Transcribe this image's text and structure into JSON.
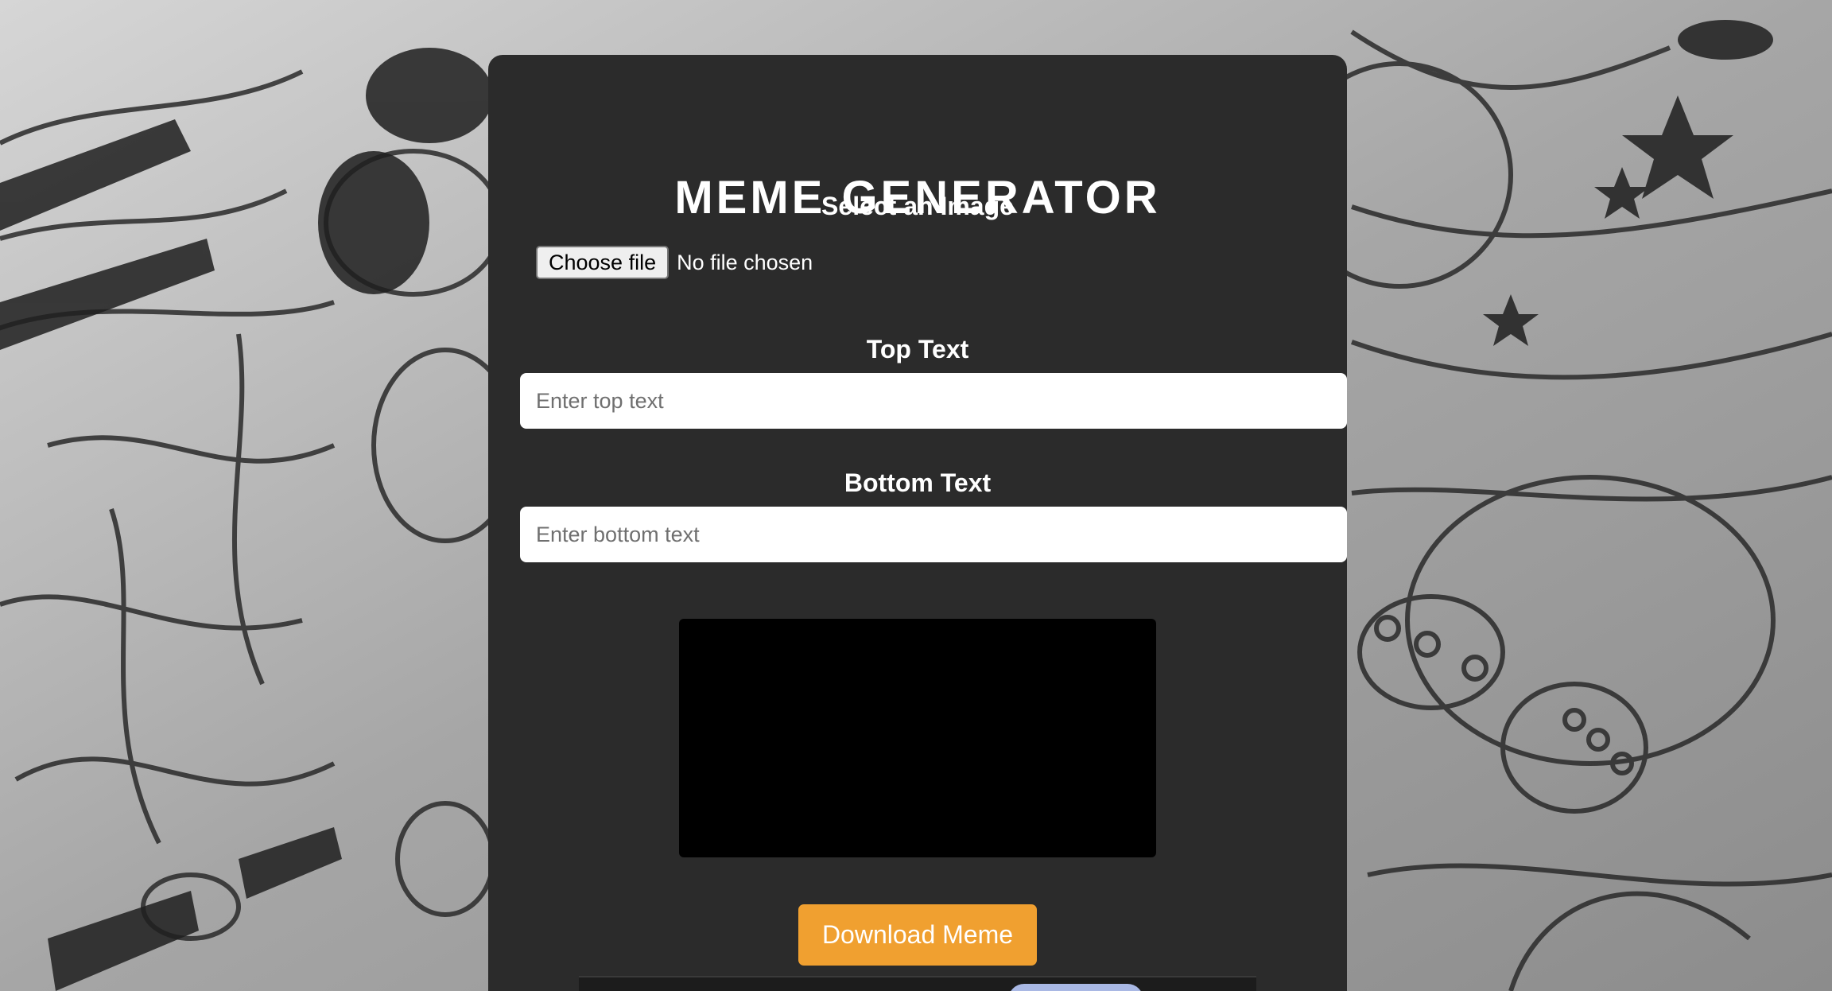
{
  "app": {
    "title": "MEME GENERATOR"
  },
  "image_select": {
    "label": "Select an Image",
    "button_label": "Choose file",
    "status": "No file chosen"
  },
  "top_text": {
    "label": "Top Text",
    "value": "",
    "placeholder": "Enter top text"
  },
  "bottom_text": {
    "label": "Bottom Text",
    "value": "",
    "placeholder": "Enter bottom text"
  },
  "download": {
    "label": "Download Meme"
  },
  "colors": {
    "card_bg": "#2b2b2b",
    "accent": "#f0a030",
    "canvas_bg": "#000000",
    "text": "#ffffff"
  }
}
